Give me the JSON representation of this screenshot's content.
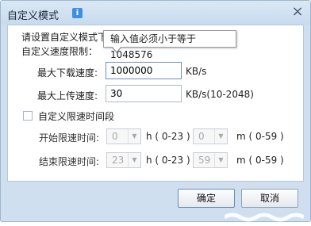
{
  "window": {
    "title": "自定义模式",
    "info_icon_glyph": "i",
    "close_glyph": "×"
  },
  "intro_text": "请设置自定义模式下的限速时间段和速度限制",
  "speed_section_label": "自定义速度限制：",
  "tooltip": "输入值必须小于等于1048576",
  "download": {
    "label": "最大下载速度:",
    "value": "1000000",
    "unit": "KB/s"
  },
  "upload": {
    "label": "最大上传速度:",
    "value": "30",
    "unit": "KB/s(10-2048)"
  },
  "time_period": {
    "checkbox_label": "自定义限速时间段",
    "checked": false,
    "start": {
      "label": "开始限速时间:",
      "hour": "0",
      "hour_unit": "h ( 0-23 )",
      "minute": "0",
      "minute_unit": "m ( 0-59 )"
    },
    "end": {
      "label": "结束限速时间:",
      "hour": "23",
      "hour_unit": "h ( 0-23 )",
      "minute": "59",
      "minute_unit": "m ( 0-59 )"
    }
  },
  "buttons": {
    "ok": "确定",
    "cancel": "取消"
  }
}
